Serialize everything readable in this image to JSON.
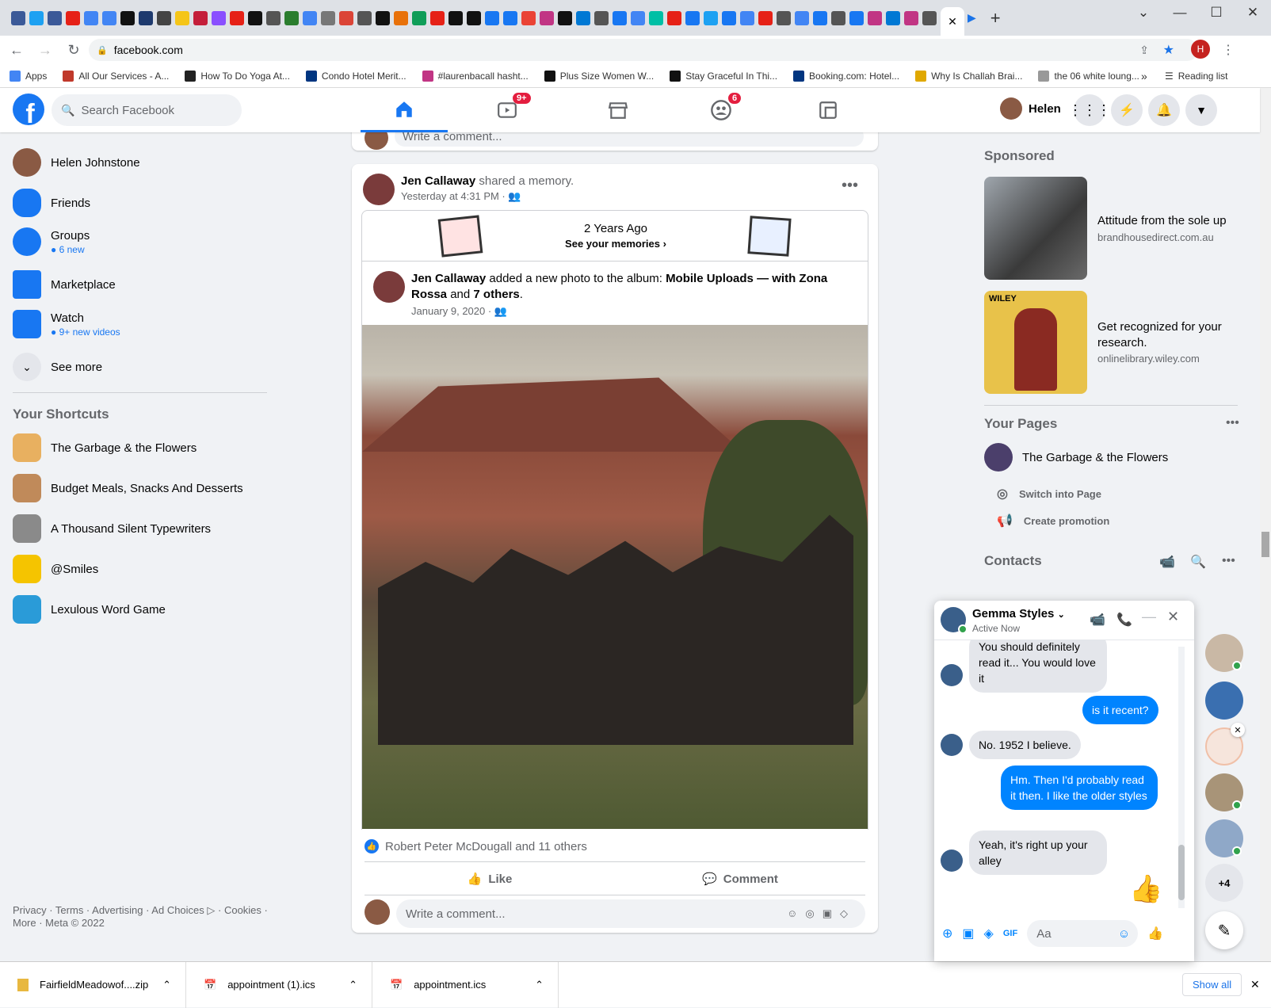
{
  "browser": {
    "url": "facebook.com",
    "profile_initial": "H",
    "bookmarks": [
      {
        "label": "Apps",
        "color": "#4285f4"
      },
      {
        "label": "All Our Services - A...",
        "color": "#c0392b"
      },
      {
        "label": "How To Do Yoga At...",
        "color": "#222222"
      },
      {
        "label": "Condo Hotel Merit...",
        "color": "#003580"
      },
      {
        "label": "#laurenbacall hasht...",
        "color": "#c13584"
      },
      {
        "label": "Plus Size Women W...",
        "color": "#111111"
      },
      {
        "label": "Stay Graceful In Thi...",
        "color": "#111111"
      },
      {
        "label": "Booking.com: Hotel...",
        "color": "#003580"
      },
      {
        "label": "Why Is Challah Brai...",
        "color": "#e0a800"
      },
      {
        "label": "the 06 white loung...",
        "color": "#999999"
      }
    ],
    "reading_list": "Reading list",
    "more_bookmarks": "»"
  },
  "header": {
    "search_placeholder": "Search Facebook",
    "watch_badge": "9+",
    "groups_badge": "6",
    "user_name": "Helen"
  },
  "left_nav": {
    "items": [
      {
        "label": "Helen Johnstone",
        "sub": ""
      },
      {
        "label": "Friends",
        "sub": ""
      },
      {
        "label": "Groups",
        "sub": "● 6 new"
      },
      {
        "label": "Marketplace",
        "sub": ""
      },
      {
        "label": "Watch",
        "sub": "● 9+ new videos"
      },
      {
        "label": "See more",
        "sub": ""
      }
    ],
    "shortcuts_title": "Your Shortcuts",
    "shortcuts": [
      "The Garbage & the Flowers",
      "Budget Meals, Snacks And Desserts",
      "A Thousand Silent Typewriters",
      "@Smiles",
      "Lexulous Word Game"
    ],
    "footer_line1": "Privacy · Terms · Advertising · Ad Choices ▷ · Cookies ·",
    "footer_line2": "More · Meta © 2022"
  },
  "feed": {
    "top_comment_placeholder": "Write a comment...",
    "post": {
      "author": "Jen Callaway",
      "action": " shared a memory.",
      "time": "Yesterday at 4:31 PM · ",
      "memory_title": "2 Years Ago",
      "memory_link": "See your memories ›",
      "inner_author": "Jen Callaway",
      "inner_action": " added a new photo to the album: ",
      "album": "Mobile Uploads — with ",
      "tagged": "Zona Rossa",
      "and": " and ",
      "others": "7 others",
      "period": ".",
      "inner_date": "January 9, 2020 · ",
      "reactions": "Robert Peter McDougall and 11 others",
      "like": "Like",
      "comment": "Comment",
      "comment_placeholder": "Write a comment..."
    }
  },
  "right": {
    "sponsored_title": "Sponsored",
    "ads": [
      {
        "title": "Attitude from the sole up",
        "domain": "brandhousedirect.com.au"
      },
      {
        "title": "Get recognized for your research.",
        "domain": "onlinelibrary.wiley.com",
        "brand": "WILEY"
      }
    ],
    "pages_title": "Your Pages",
    "page_name": "The Garbage & the Flowers",
    "switch_page": "Switch into Page",
    "create_promotion": "Create promotion",
    "contacts_title": "Contacts"
  },
  "chat": {
    "name": "Gemma Styles",
    "status": "Active Now",
    "messages": [
      {
        "text": "You should definitely read it... You would love it",
        "dir": "in"
      },
      {
        "text": "is it recent?",
        "dir": "out"
      },
      {
        "text": "No.  1952 I believe.",
        "dir": "in"
      },
      {
        "text": "Hm. Then I'd probably read it then. I like the older styles",
        "dir": "out"
      },
      {
        "text": "Yeah,  it's right up your alley",
        "dir": "in"
      }
    ],
    "input_placeholder": "Aa"
  },
  "downloads": {
    "files": [
      "FairfieldMeadowof....zip",
      "appointment (1).ics",
      "appointment.ics"
    ],
    "show_all": "Show all"
  },
  "contact_bubbles_more": "+4"
}
